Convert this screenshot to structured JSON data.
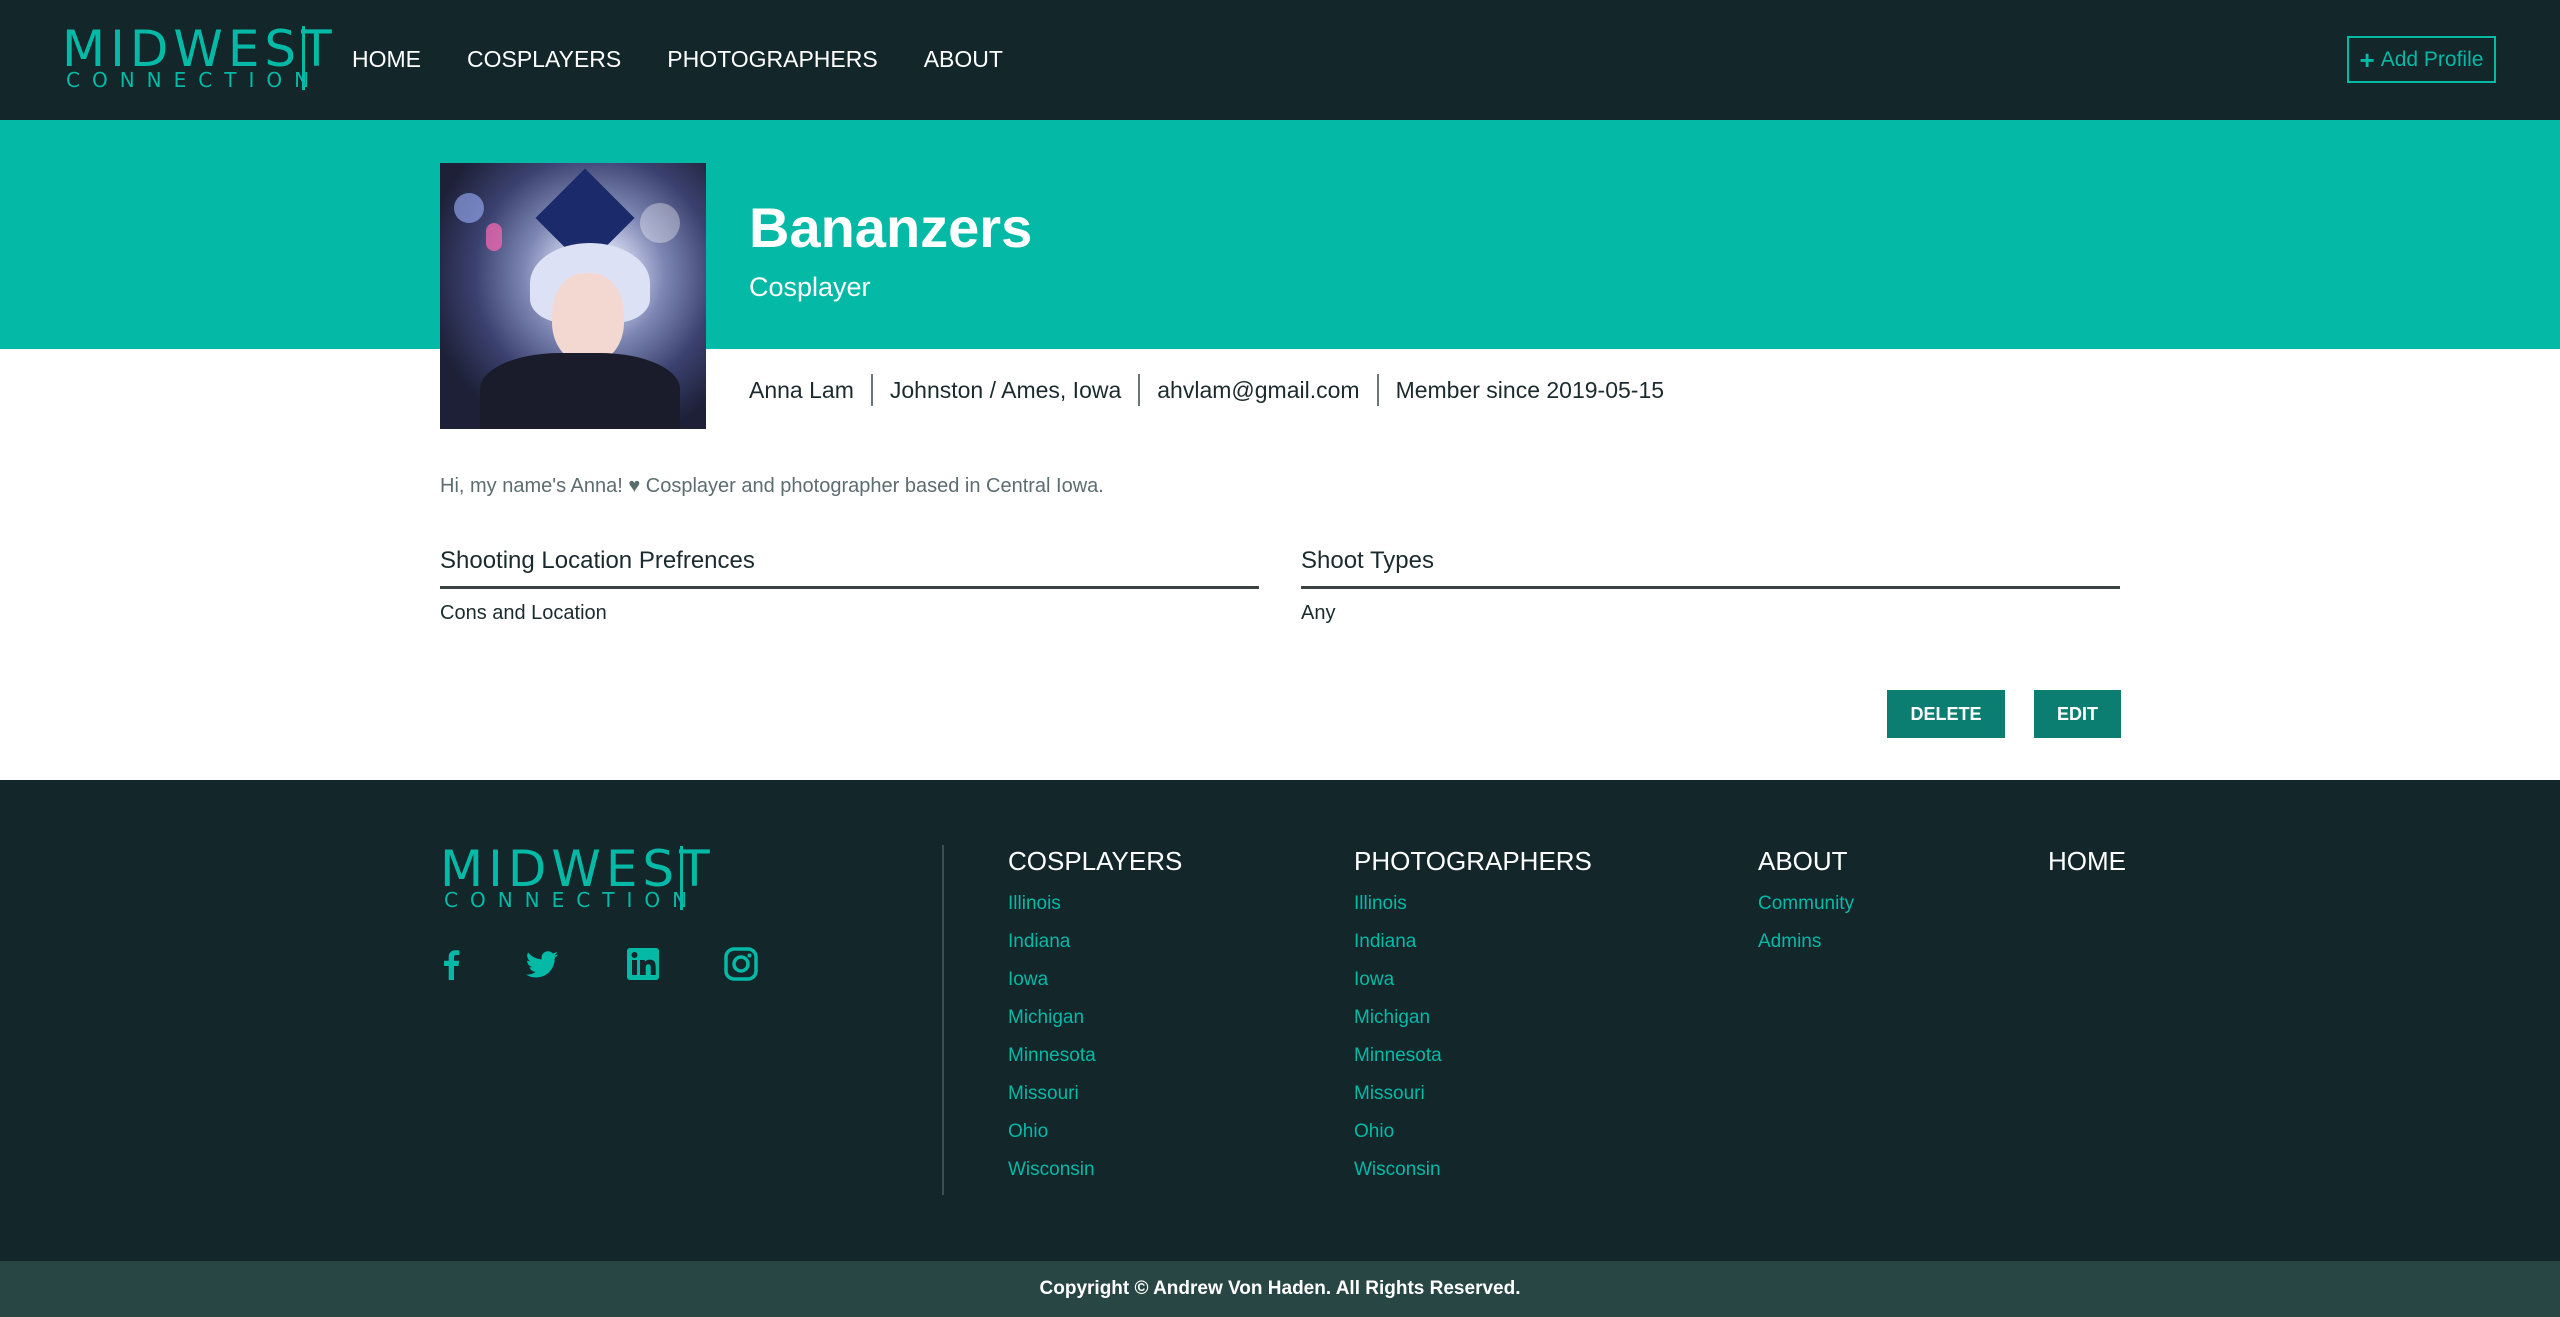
{
  "brand": {
    "logo_top": "MIDWEST",
    "logo_bottom": "CONNECTION",
    "accent": "#04b9a6",
    "dark": "#13272b"
  },
  "nav": {
    "items": [
      "HOME",
      "COSPLAYERS",
      "PHOTOGRAPHERS",
      "ABOUT"
    ]
  },
  "header": {
    "add_profile_label": "Add Profile"
  },
  "profile": {
    "name": "Bananzers",
    "role": "Cosplayer",
    "real_name": "Anna Lam",
    "location": "Johnston / Ames, Iowa",
    "email": "ahvlam@gmail.com",
    "member_since": "Member since 2019-05-15",
    "bio": "Hi, my name's Anna! ♥ Cosplayer and photographer based in Central Iowa.",
    "shooting_location_title": "Shooting Location Prefrences",
    "shooting_location_value": "Cons and Location",
    "shoot_types_title": "Shoot Types",
    "shoot_types_value": "Any"
  },
  "actions": {
    "delete_label": "DELETE",
    "edit_label": "EDIT"
  },
  "footer": {
    "social_icons": [
      "facebook-icon",
      "twitter-icon",
      "linkedin-icon",
      "instagram-icon"
    ],
    "cosplayers": {
      "title": "COSPLAYERS",
      "links": [
        "Illinois",
        "Indiana",
        "Iowa",
        "Michigan",
        "Minnesota",
        "Missouri",
        "Ohio",
        "Wisconsin"
      ]
    },
    "photographers": {
      "title": "PHOTOGRAPHERS",
      "links": [
        "Illinois",
        "Indiana",
        "Iowa",
        "Michigan",
        "Minnesota",
        "Missouri",
        "Ohio",
        "Wisconsin"
      ]
    },
    "about": {
      "title": "ABOUT",
      "links": [
        "Community",
        "Admins"
      ]
    },
    "home": {
      "title": "HOME"
    },
    "copyright": "Copyright © Andrew Von Haden. All Rights Reserved."
  }
}
